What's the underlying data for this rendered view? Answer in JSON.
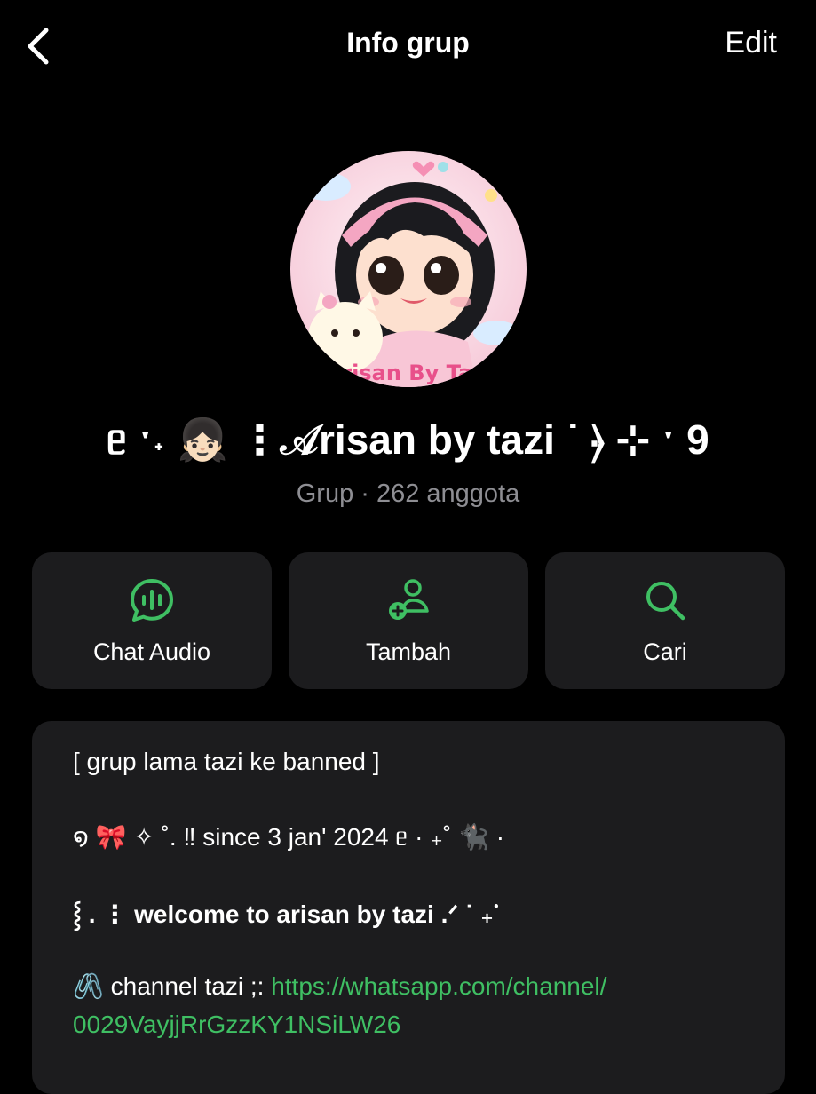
{
  "header": {
    "title": "Info grup",
    "edit_label": "Edit"
  },
  "group": {
    "name": "ᥱ ˑ˖ 👧🏻 ⋮𝒜risan by tazi ˙ ⦒ ⊹ ˑ 9",
    "meta": "Grup · 262 anggota",
    "avatar_text": "Arisan By Tazi"
  },
  "actions": [
    {
      "label": "Chat Audio",
      "icon": "audio-chat-icon"
    },
    {
      "label": "Tambah",
      "icon": "add-person-icon"
    },
    {
      "label": "Cari",
      "icon": "search-icon"
    }
  ],
  "description": {
    "line1": "[ grup lama tazi ke banned ]",
    "line2": "໑ 🎀 ✧ ˚. ‼ since 3 jan' 2024 ᥱ · ₊˚ 🐈‍⬛ ·",
    "line3": "⸾ . ⋮ welcome to arisan by tazi .ᐟ ˙ ₊ᣟ",
    "line4_prefix": "🖇️ channel tazi ;: ",
    "line4_link": "https://whatsapp.com/channel/",
    "line5_link": "0029VayjjRrGzzKY1NSiLW26"
  },
  "colors": {
    "accent_green": "#3fbf63",
    "card_bg": "#1c1c1e",
    "secondary_text": "#8e8e93"
  }
}
